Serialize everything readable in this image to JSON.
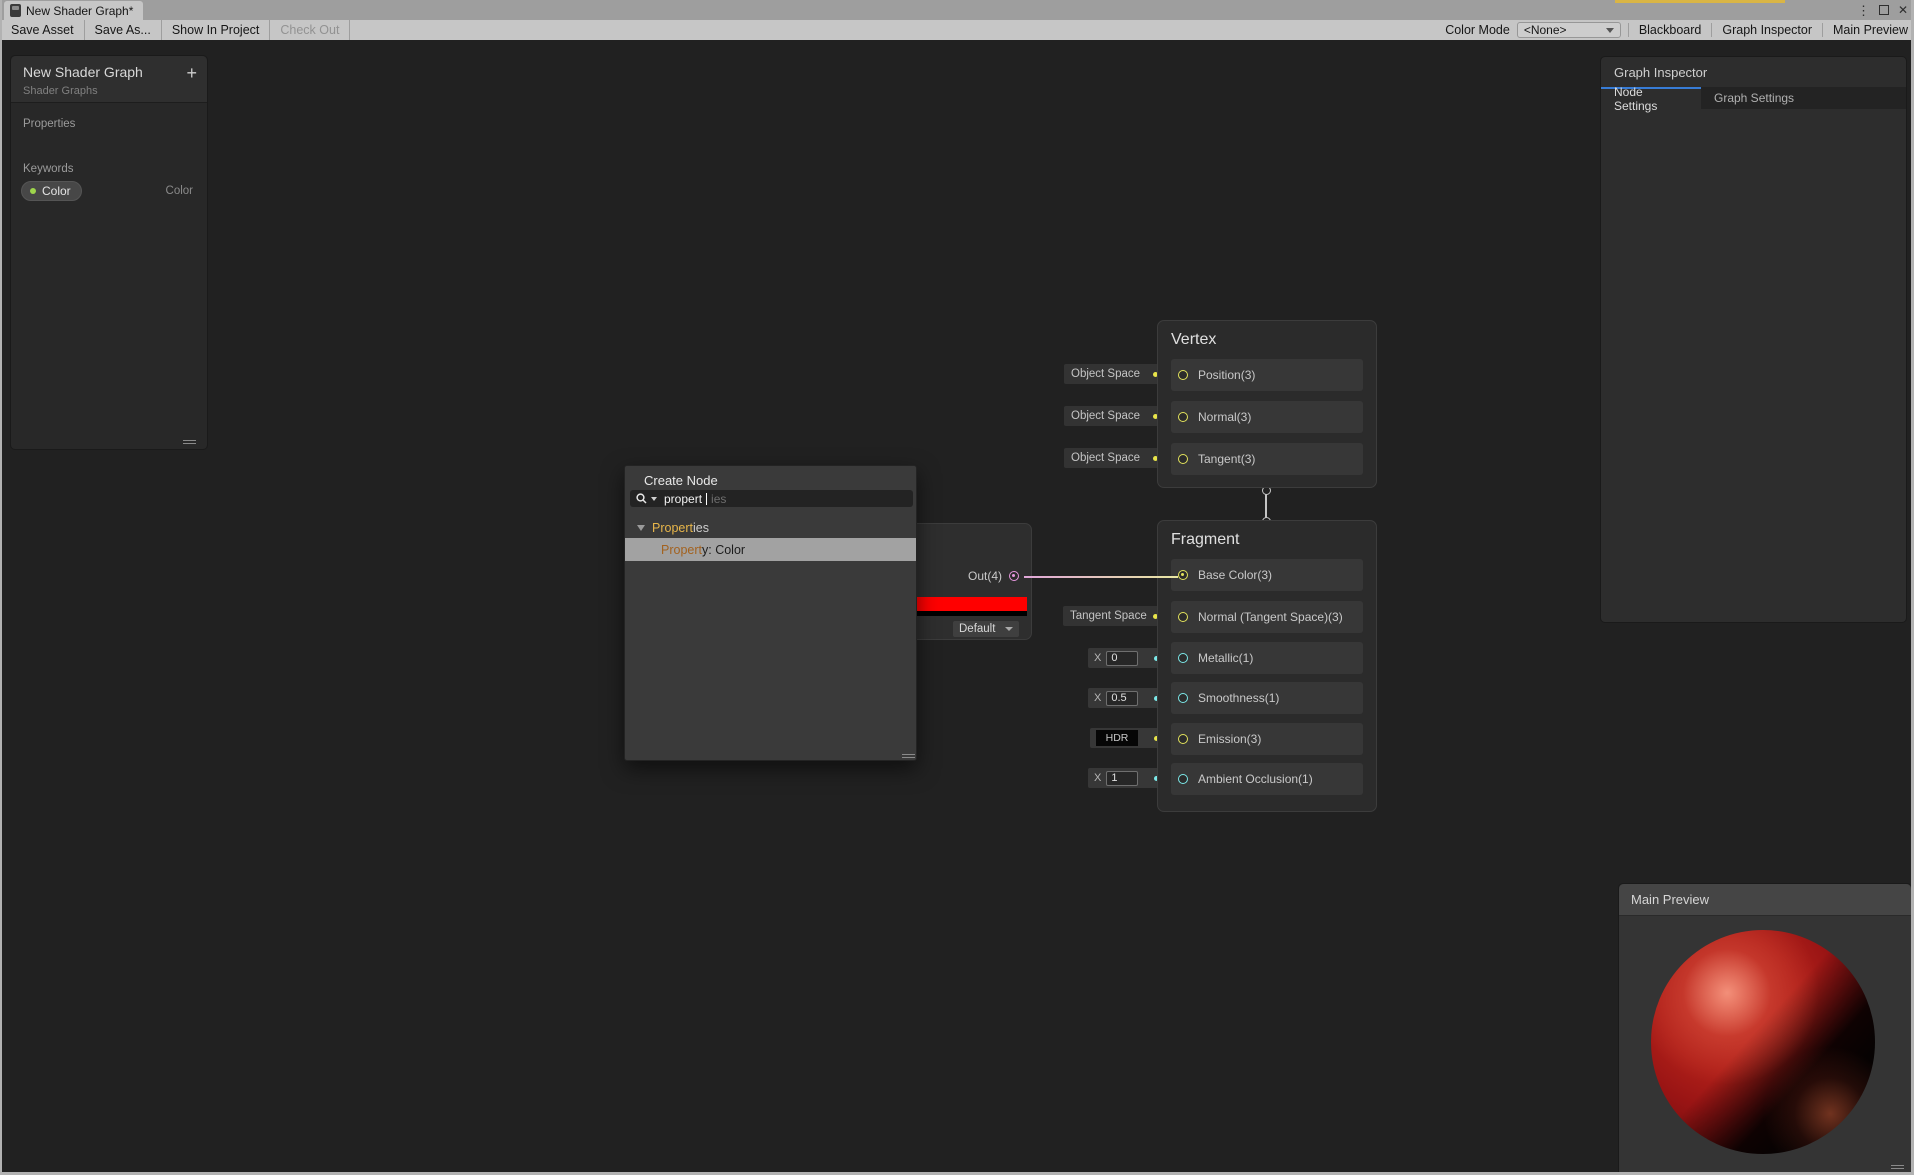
{
  "window": {
    "tab_title": "New Shader Graph*",
    "menu_icon": "⋮",
    "close_icon": "✕"
  },
  "toolbar": {
    "save_asset": "Save Asset",
    "save_as": "Save As...",
    "show_in_project": "Show In Project",
    "check_out": "Check Out",
    "color_mode_label": "Color Mode",
    "color_mode_value": "<None>",
    "blackboard": "Blackboard",
    "graph_inspector": "Graph Inspector",
    "main_preview": "Main Preview"
  },
  "blackboard": {
    "title": "New Shader Graph",
    "subtitle": "Shader Graphs",
    "add_glyph": "+",
    "properties_label": "Properties",
    "keywords_label": "Keywords",
    "property": {
      "name": "Color",
      "type": "Color"
    }
  },
  "graph_inspector": {
    "title": "Graph Inspector",
    "tab_node_settings": "Node Settings",
    "tab_graph_settings": "Graph Settings"
  },
  "main_preview": {
    "title": "Main Preview"
  },
  "create_node": {
    "title": "Create Node",
    "search_typed": "propert",
    "search_ghost": "ies",
    "category_match": "Propert",
    "category_rest": "ies",
    "result_match": "Propert",
    "result_rest": "y: Color"
  },
  "color_node": {
    "out_label": "Out(4)",
    "dropdown_value": "Default",
    "swatch_color": "#ff0000"
  },
  "vertex_node": {
    "title": "Vertex",
    "slot0": {
      "tag": "Object Space",
      "label": "Position(3)"
    },
    "slot1": {
      "tag": "Object Space",
      "label": "Normal(3)"
    },
    "slot2": {
      "tag": "Object Space",
      "label": "Tangent(3)"
    }
  },
  "fragment_node": {
    "title": "Fragment",
    "slot0": {
      "label": "Base Color(3)"
    },
    "slot1": {
      "tag": "Tangent Space",
      "label": "Normal (Tangent Space)(3)"
    },
    "slot2": {
      "x": "X",
      "value": "0",
      "label": "Metallic(1)"
    },
    "slot3": {
      "x": "X",
      "value": "0.5",
      "label": "Smoothness(1)"
    },
    "slot4": {
      "hdr": "HDR",
      "label": "Emission(3)"
    },
    "slot5": {
      "x": "X",
      "value": "1",
      "label": "Ambient Occlusion(1)"
    }
  },
  "colors": {
    "accent_blue": "#377cd6",
    "port_vec3_yellow": "#e3e35c",
    "port_vec1_cyan": "#7ce9e9",
    "port_vec4_pink": "#e596dd",
    "swatch_red": "#ff0000",
    "search_match_yellow": "#e8b64a",
    "notification_yellow": "#d9b545",
    "canvas": "#212121"
  }
}
